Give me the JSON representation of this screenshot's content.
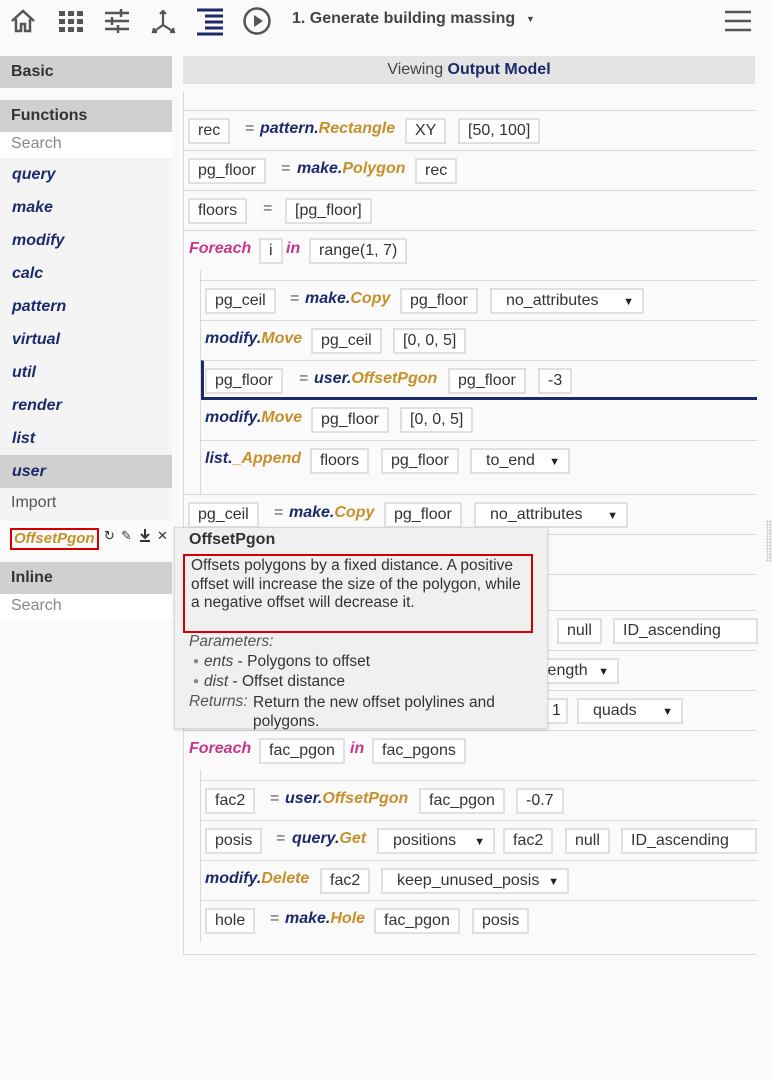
{
  "toolbar": {
    "icons": [
      "home-icon",
      "grid-icon",
      "sliders-icon",
      "axes-icon",
      "list-icon",
      "play-icon"
    ],
    "flow_title": "1. Generate building massing",
    "menu_icon": "hamburger-icon"
  },
  "left_panel": {
    "basic_label": "Basic",
    "functions_label": "Functions",
    "search_placeholder": "Search",
    "modules": [
      "query",
      "make",
      "modify",
      "calc",
      "pattern",
      "virtual",
      "util",
      "render",
      "list",
      "user"
    ],
    "active_module": "user",
    "import_label": "Import",
    "user_function": "OffsetPgon",
    "inline_label": "Inline",
    "inline_search_placeholder": "Search"
  },
  "viewer": {
    "prefix": "Viewing",
    "model": "Output Model"
  },
  "code": {
    "l1": {
      "var": "rec",
      "eq": "=",
      "mod": "pattern.",
      "fn": "Rectangle",
      "a1": "XY",
      "a2": "[50, 100]"
    },
    "l2": {
      "var": "pg_floor",
      "eq": "=",
      "mod": "make.",
      "fn": "Polygon",
      "a1": "rec"
    },
    "l3": {
      "var": "floors",
      "eq": "=",
      "a1": "[pg_floor]"
    },
    "l4": {
      "kw": "Foreach",
      "var": "i",
      "in": "in",
      "a1": "range(1, 7)"
    },
    "l5": {
      "var": "pg_ceil",
      "eq": "=",
      "mod": "make.",
      "fn": "Copy",
      "a1": "pg_floor",
      "a2": "no_attributes"
    },
    "l6": {
      "mod": "modify.",
      "fn": "Move",
      "a1": "pg_ceil",
      "a2": "[0, 0, 5]"
    },
    "l7": {
      "var": "pg_floor",
      "eq": "=",
      "mod": "user.",
      "fn": "OffsetPgon",
      "a1": "pg_floor",
      "a2": "-3"
    },
    "l8": {
      "mod": "modify.",
      "fn": "Move",
      "a1": "pg_floor",
      "a2": "[0, 0, 5]"
    },
    "l9": {
      "mod": "list.",
      "fn": "_Append",
      "a1": "floors",
      "a2": "pg_floor",
      "a3": "to_end"
    },
    "l10": {
      "var": "pg_ceil",
      "eq": "=",
      "mod": "make.",
      "fn": "Copy",
      "a1": "pg_floor",
      "a2": "no_attributes"
    },
    "l13": {
      "a1": "null",
      "a2": "ID_ascending"
    },
    "l14": {
      "a1": "length"
    },
    "l15": {
      "a1": "1",
      "a2": "quads"
    },
    "l16": {
      "kw": "Foreach",
      "var": "fac_pgon",
      "in": "in",
      "a1": "fac_pgons"
    },
    "l17": {
      "var": "fac2",
      "eq": "=",
      "mod": "user.",
      "fn": "OffsetPgon",
      "a1": "fac_pgon",
      "a2": "-0.7"
    },
    "l18": {
      "var": "posis",
      "eq": "=",
      "mod": "query.",
      "fn": "Get",
      "a1": "positions",
      "a2": "fac2",
      "a3": "null",
      "a4": "ID_ascending"
    },
    "l19": {
      "mod": "modify.",
      "fn": "Delete",
      "a1": "fac2",
      "a2": "keep_unused_posis"
    },
    "l20": {
      "var": "hole",
      "eq": "=",
      "mod": "make.",
      "fn": "Hole",
      "a1": "fac_pgon",
      "a2": "posis"
    }
  },
  "tooltip": {
    "title": "OffsetPgon",
    "description": "Offsets polygons by a fixed distance. A positive offset will increase the size of the polygon, while a negative offset will decrease it.",
    "params_label": "Parameters:",
    "params": [
      {
        "name": "ents",
        "sep": " - ",
        "desc": "Polygons to offset"
      },
      {
        "name": "dist",
        "sep": " - ",
        "desc": "Offset distance"
      }
    ],
    "returns_label": "Returns:",
    "returns": "Return the new offset polylines and polygons."
  }
}
